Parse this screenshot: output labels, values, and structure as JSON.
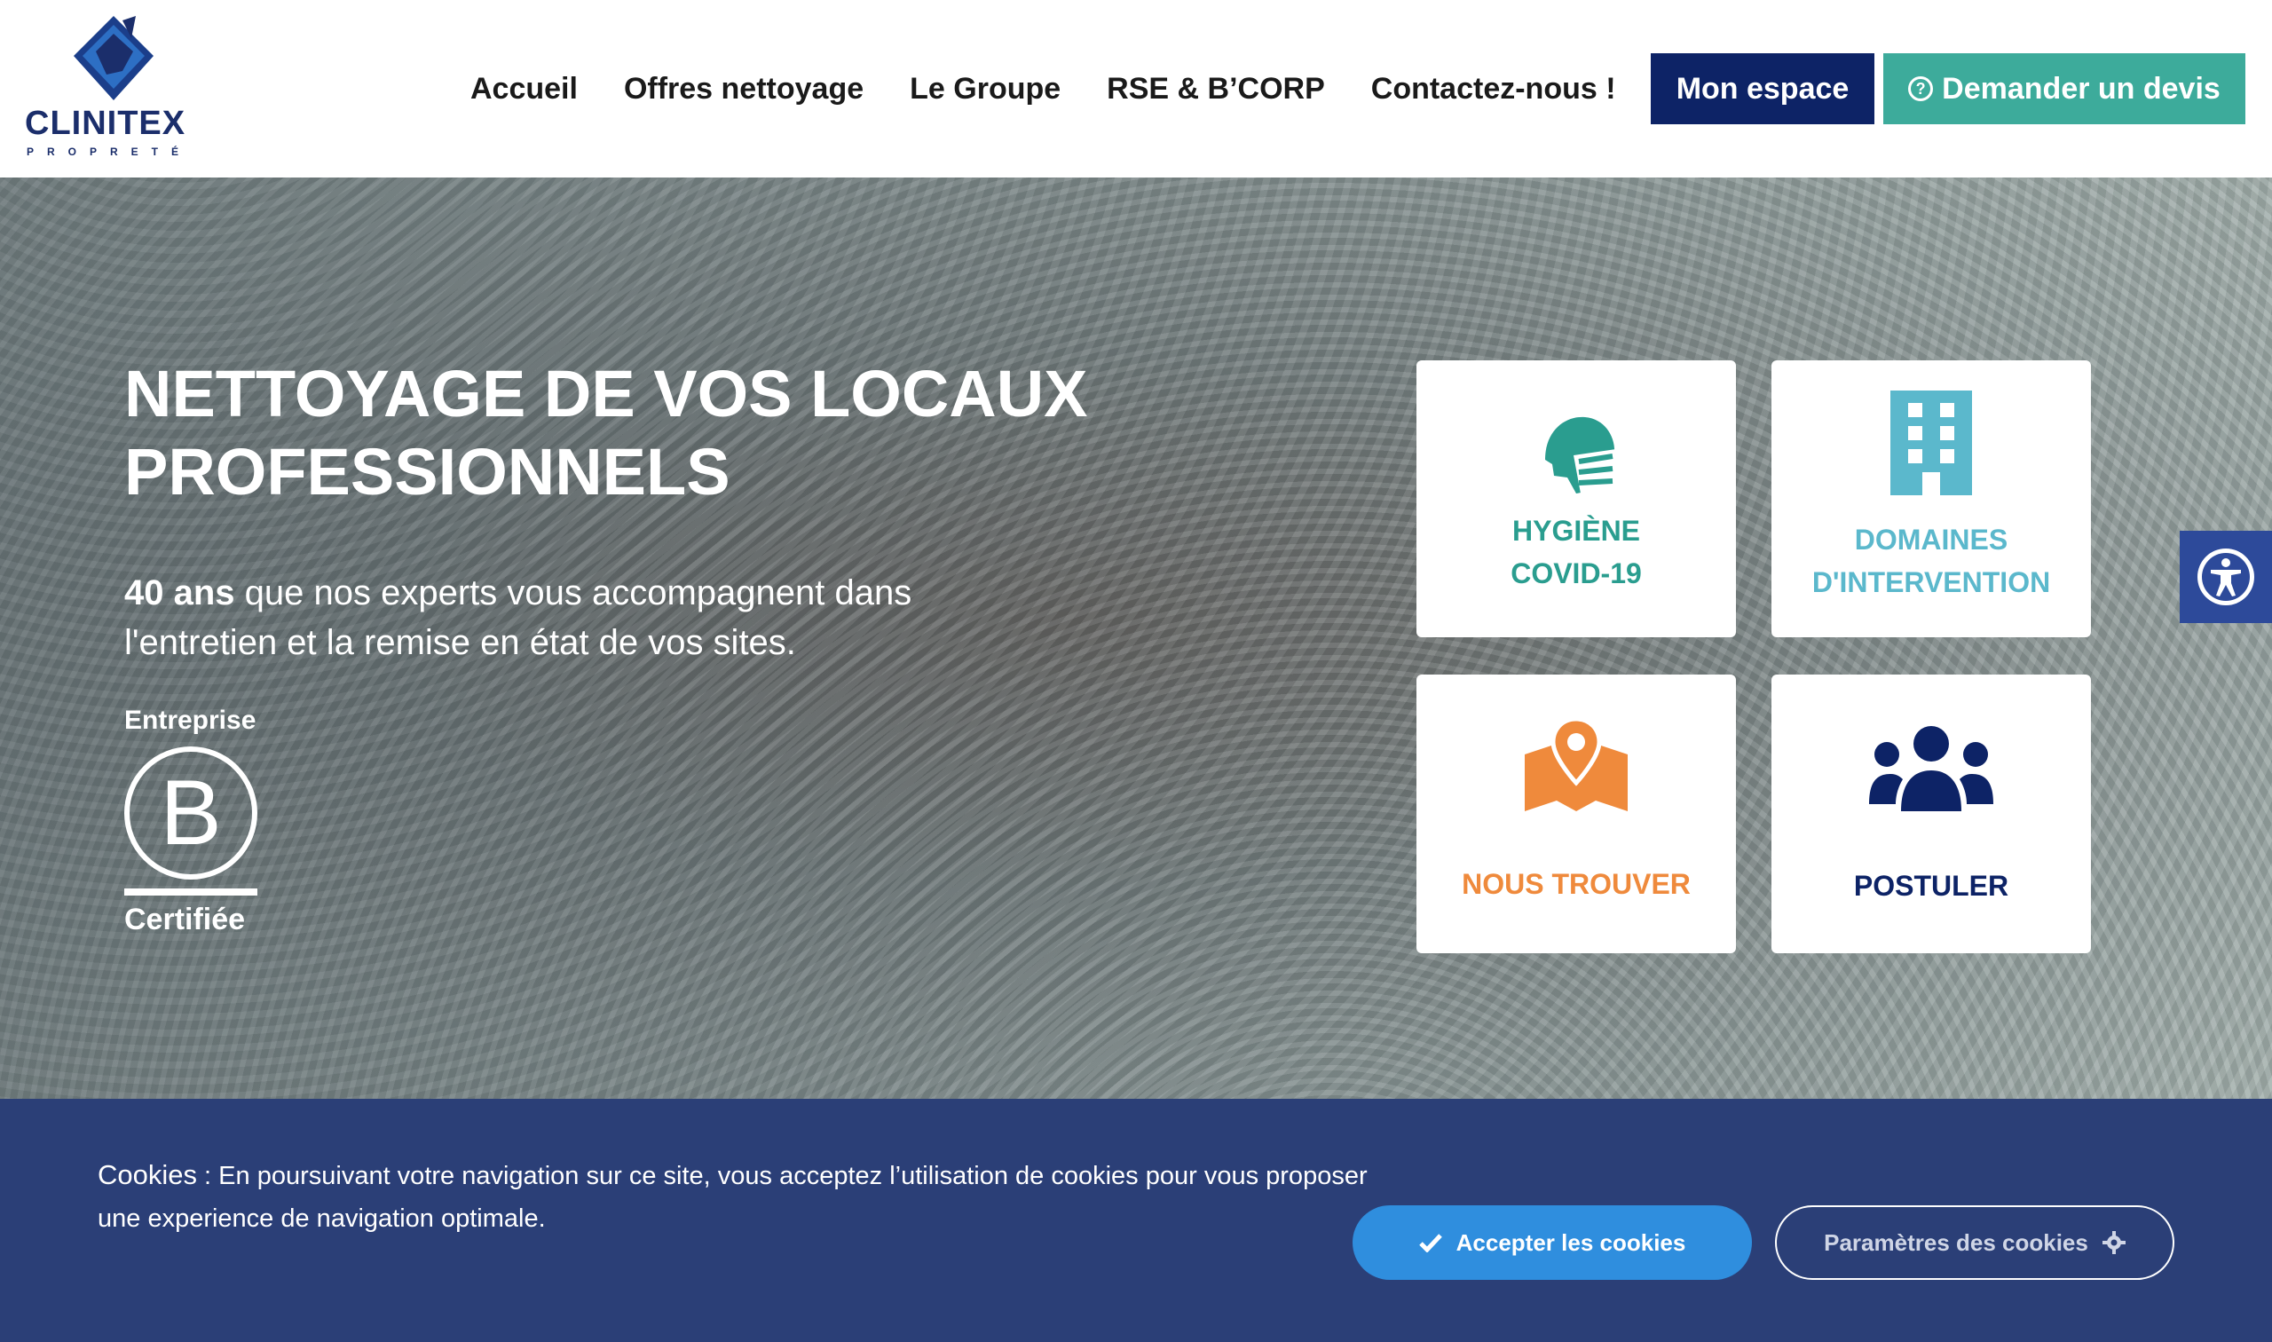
{
  "header": {
    "logo": {
      "name": "CLINITEX",
      "sub": "PROPRETÉ"
    },
    "nav": [
      "Accueil",
      "Offres nettoyage",
      "Le Groupe",
      "RSE & B’CORP",
      "Contactez-nous !"
    ],
    "espace_label": "Mon espace",
    "devis_label": "Demander un devis"
  },
  "hero": {
    "title_line1": "NETTOYAGE DE VOS LOCAUX",
    "title_line2": "PROFESSIONNELS",
    "desc_bold": "40 ans",
    "desc_rest": " que nos experts vous accompagnent dans",
    "desc_line2": "l'entretien et la remise en état de vos sites.",
    "bcorp": {
      "top": "Entreprise",
      "letter": "B",
      "bottom": "Certifiée"
    }
  },
  "cards": [
    {
      "line1": "HYGIÈNE",
      "line2": "COVID-19",
      "color": "#2a9d8f",
      "icon": "head-mask-icon"
    },
    {
      "line1": "DOMAINES",
      "line2": "D'INTERVENTION",
      "color": "#5bb8cc",
      "icon": "building-icon"
    },
    {
      "line1": "NOUS TROUVER",
      "line2": "",
      "color": "#ef8a3c",
      "icon": "map-pin-icon"
    },
    {
      "line1": "POSTULER",
      "line2": "",
      "color": "#0d2366",
      "icon": "users-icon"
    }
  ],
  "cookie": {
    "lead": "Cookies",
    "text": " : En poursuivant votre navigation sur ce site, vous acceptez l’utilisation de cookies pour vous proposer une experience de navigation optimale.",
    "accept_label": "Accepter les cookies",
    "params_label": "Paramètres des cookies"
  },
  "colors": {
    "navy": "#0d2366",
    "teal": "#3dab9b",
    "cookie_bg": "#2b3f77",
    "accept_blue": "#2f8ede"
  }
}
